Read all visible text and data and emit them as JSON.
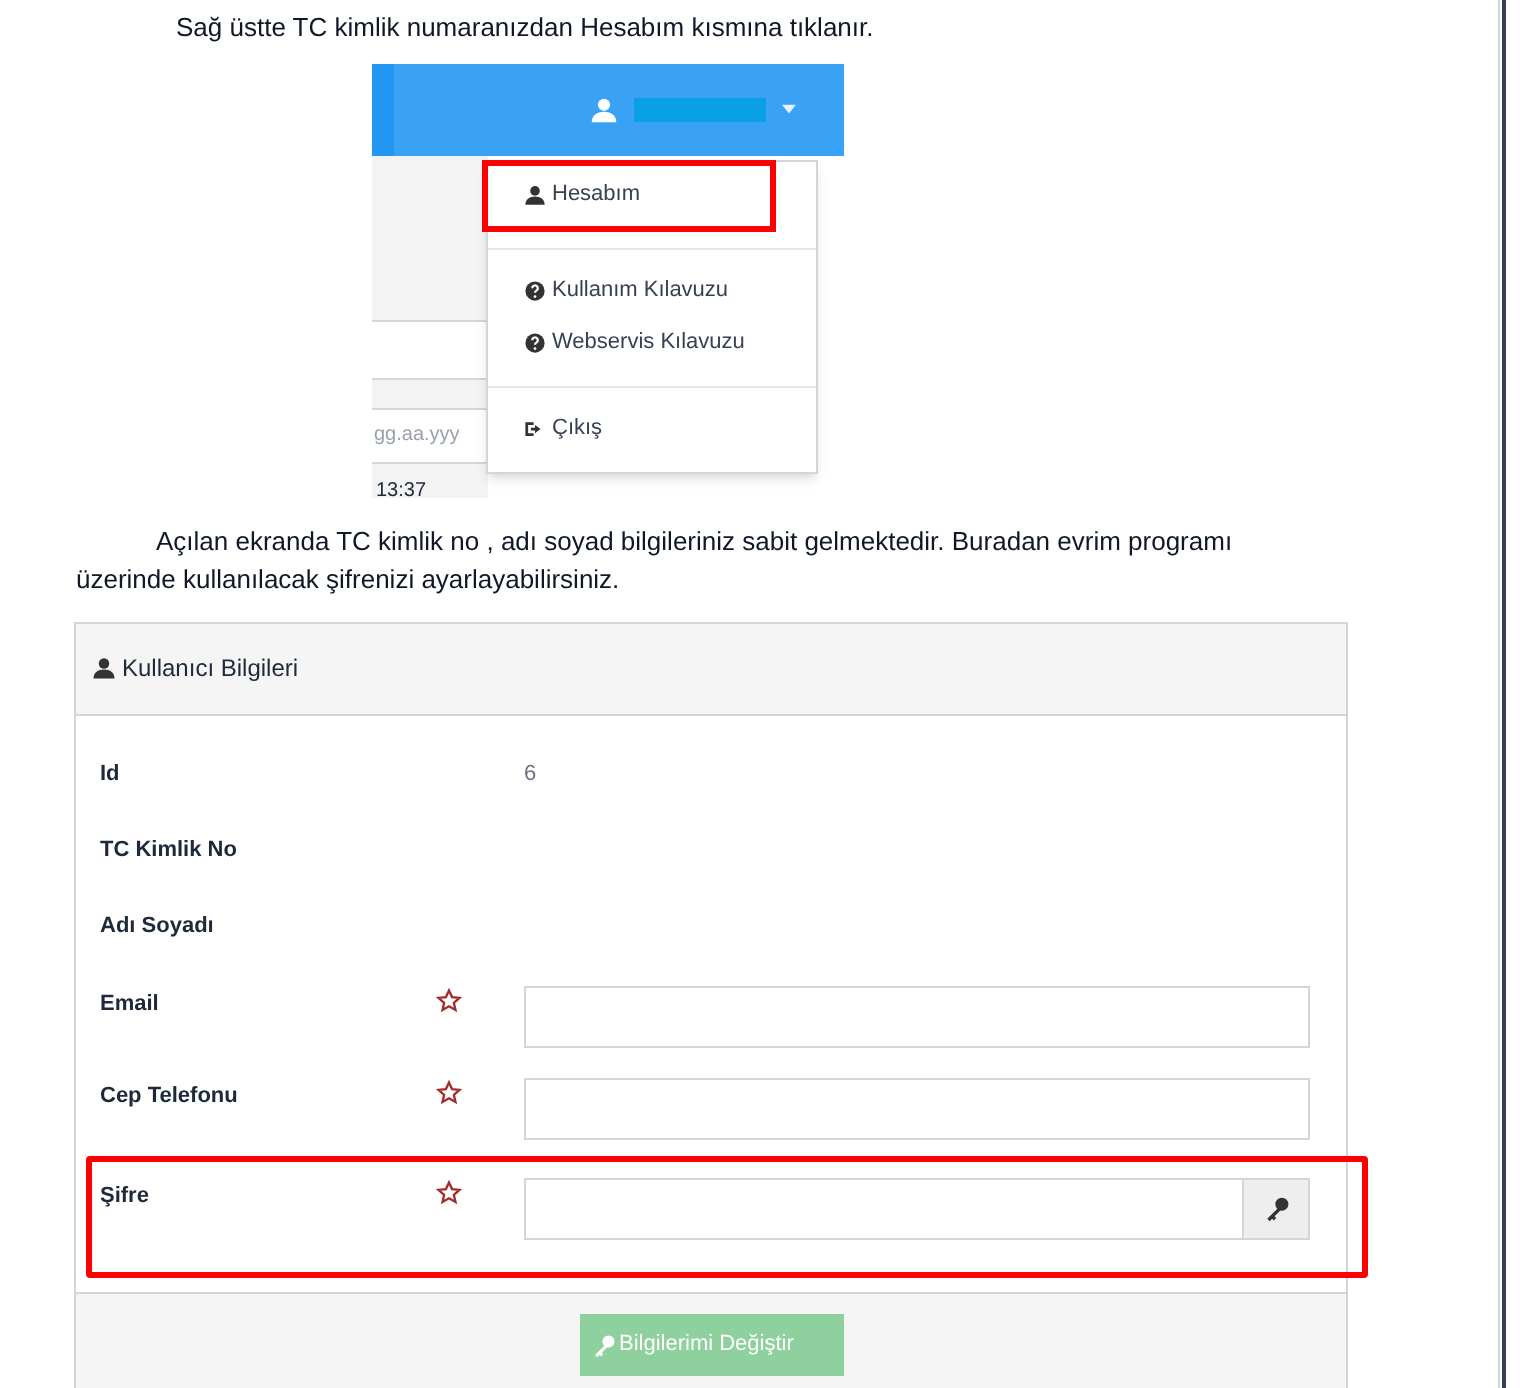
{
  "intro_text": "Sağ üstte TC kimlik numaranızdan Hesabım kısmına tıklanır.",
  "menu_screenshot": {
    "date_placeholder": "gg.aa.yyy",
    "time_text": "13:37",
    "menu_items": [
      {
        "label": "Hesabım",
        "divider_before": false,
        "highlighted": true
      },
      {
        "label": "Kullanım Kılavuzu",
        "divider_before": true,
        "highlighted": false
      },
      {
        "label": "Webservis Kılavuzu",
        "divider_before": false,
        "highlighted": false
      },
      {
        "label": "Çıkış",
        "divider_before": true,
        "highlighted": false
      }
    ]
  },
  "paragraph": "Açılan ekranda TC kimlik no , adı soyad bilgileriniz sabit gelmektedir. Buradan evrim programı üzerinde kullanılacak şifrenizi ayarlayabilirsiniz.",
  "form": {
    "title": "Kullanıcı Bilgileri",
    "fields": [
      {
        "label": "Id",
        "kind": "static",
        "value": "6",
        "required": false,
        "highlighted": false
      },
      {
        "label": "TC Kimlik No",
        "kind": "static",
        "required": false,
        "highlighted": false
      },
      {
        "label": "Adı Soyadı",
        "kind": "static",
        "required": false,
        "highlighted": false
      },
      {
        "label": "Email",
        "kind": "input",
        "required": true,
        "highlighted": false
      },
      {
        "label": "Cep Telefonu",
        "kind": "input",
        "required": true,
        "highlighted": false
      },
      {
        "label": "Şifre",
        "kind": "password",
        "required": true,
        "highlighted": true
      }
    ],
    "submit": {
      "label": "Bilgilerimi Değiştir",
      "disabled": true
    }
  }
}
